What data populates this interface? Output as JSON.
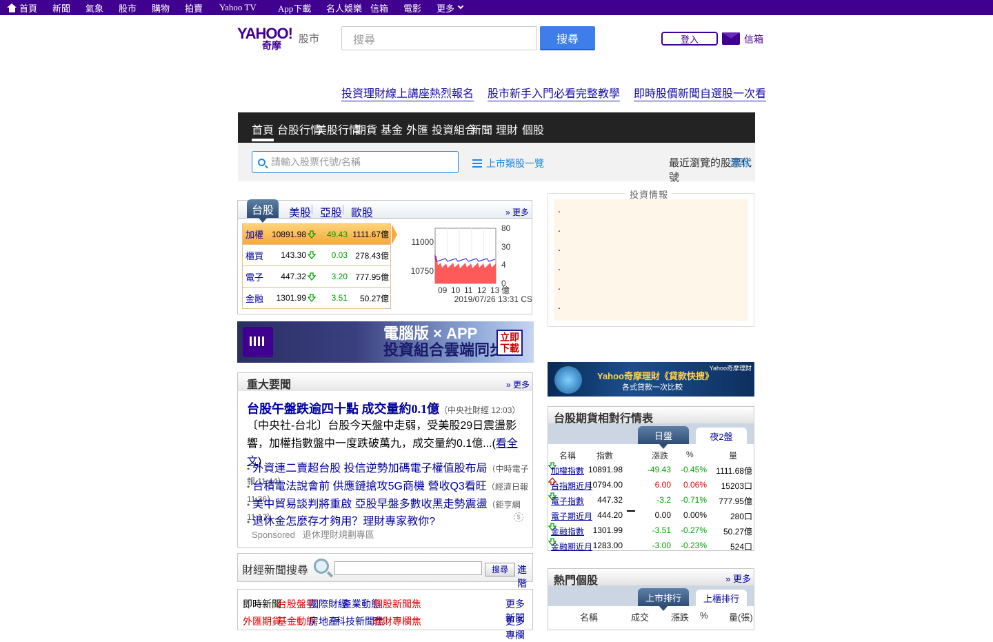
{
  "topbar": {
    "items": [
      "首頁",
      "新聞",
      "氣象",
      "股市",
      "購物",
      "拍賣",
      "Yahoo TV",
      "App下載",
      "名人娛樂",
      "信箱",
      "電影",
      "更多"
    ]
  },
  "header": {
    "logo_main": "YAHOO!",
    "logo_sub": "奇摩",
    "logo_section": "股市",
    "search_placeholder": "搜尋",
    "search_button": "搜尋",
    "login": "登入",
    "mail": "信箱"
  },
  "promo_links": [
    "投資理財線上講座熱烈報名",
    "股市新手入門必看完整教學",
    "即時股價新聞自選股一次看"
  ],
  "nav": {
    "items": [
      "首頁",
      "台股行情",
      "美股行情",
      "期貨",
      "基金",
      "外匯",
      "投資組合",
      "新聞",
      "理財",
      "個股"
    ],
    "active_index": 0
  },
  "subbar": {
    "stock_placeholder": "請輸入股票代號/名稱",
    "list_link": "上市類股一覽",
    "right_text": "最近瀏覽的股票代號",
    "right_link": "清除"
  },
  "index_box": {
    "tabs": [
      "台股",
      "美股",
      "亞股",
      "歐股"
    ],
    "more": "更多",
    "rows": [
      {
        "name": "加權",
        "value": "10891.98",
        "change": "49.43",
        "amount": "1111.67億",
        "dir": "down"
      },
      {
        "name": "櫃買",
        "value": "143.30",
        "change": "0.03",
        "amount": "278.43億",
        "dir": "down"
      },
      {
        "name": "電子",
        "value": "447.32",
        "change": "3.20",
        "amount": "777.95億",
        "dir": "down"
      },
      {
        "name": "金融",
        "value": "1301.99",
        "change": "3.51",
        "amount": "50.27億",
        "dir": "down"
      }
    ],
    "chart": {
      "left_ticks": [
        "11000",
        "10750"
      ],
      "right_ticks": [
        "80",
        "30",
        "4",
        "0"
      ],
      "right_unit": "億",
      "x_ticks": [
        "09",
        "10",
        "11",
        "12",
        "13"
      ],
      "timestamp": "2019/07/26 13:31 CST"
    }
  },
  "banner1": {
    "logo": "YAHOO!",
    "line1": "電腦版 × APP",
    "line2": "投資組合雲端同步",
    "cta": "立即下載"
  },
  "news": {
    "title": "重大要聞",
    "more": "更多",
    "lead": {
      "headline": "台股午盤跌逾四十點 成交量約0.1億",
      "source": "中央社財經 12:03"
    },
    "lead_body": "〔中央社-台北〕台股今天盤中走弱，受美股29日震盪影響，加權指數盤中一度跌破萬九，成交量約0.1億...",
    "lead_more": "看全文",
    "items": [
      {
        "title": "外資連二賣超台股 投信逆勢加碼電子權值股布局",
        "source": "中時電子報 11:44"
      },
      {
        "title": "台積電法說會前 供應鏈搶攻5G商機 營收Q3看旺",
        "source": "經濟日報 11:36"
      },
      {
        "title": "美中貿易談判將重啟 亞股早盤多數收黑走勢震盪",
        "source": "鉅亨網 11:17"
      },
      {
        "title": "退休金怎麼存才夠用？理財專家教你?",
        "source": ""
      }
    ],
    "sponsored": "Sponsored",
    "sponsor_name": "退休理財規劃專區"
  },
  "news_search": {
    "label": "財經新聞搜尋",
    "button": "搜尋",
    "more": "進階"
  },
  "categories": {
    "row1": [
      "即時新聞",
      "台股盤勢",
      "國際財經",
      "產業動態",
      "個股新聞焦",
      "更多新聞"
    ],
    "row2": [
      "外匯期貨",
      "基金動態",
      "房地產",
      "科技新聞焦",
      "理財專欄焦",
      "更多專欄"
    ]
  },
  "invest": {
    "title": "投資情報",
    "items": [
      ".",
      ".",
      ".",
      ".",
      ".",
      "."
    ]
  },
  "banner2": {
    "corner": "Yahoo奇摩理財",
    "line1": "Yahoo奇摩理財《貸款快搜》",
    "line2": "各式貸款一次比較"
  },
  "futures": {
    "title": "台股期貨相對行情表",
    "tabs": [
      "日盤",
      "夜2盤"
    ],
    "headers": [
      "名稱",
      "指數",
      "漲跌",
      "%",
      "量"
    ],
    "rows": [
      {
        "name": "加權指數",
        "value": "10891.98",
        "dir": "down",
        "change": "-49.43",
        "pct": "-0.45%",
        "vol": "1111.68億",
        "color": "#00a000"
      },
      {
        "name": "台指期近月",
        "value": "10794.00",
        "dir": "up",
        "change": "6.00",
        "pct": "0.06%",
        "vol": "15203口",
        "color": "#e00000"
      },
      {
        "name": "電子指數",
        "value": "447.32",
        "dir": "down",
        "change": "-3.2",
        "pct": "-0.71%",
        "vol": "777.95億",
        "color": "#00a000"
      },
      {
        "name": "電子期近月",
        "value": "444.20",
        "dir": "flat",
        "change": "0.00",
        "pct": "0.00%",
        "vol": "280口",
        "color": "#000000"
      },
      {
        "name": "金融指數",
        "value": "1301.99",
        "dir": "down",
        "change": "-3.51",
        "pct": "-0.27%",
        "vol": "50.27億",
        "color": "#00a000"
      },
      {
        "name": "金融期近月",
        "value": "1283.00",
        "dir": "down",
        "change": "-3.00",
        "pct": "-0.23%",
        "vol": "524口",
        "color": "#00a000"
      }
    ]
  },
  "hot": {
    "title": "熱門個股",
    "more": "更多",
    "tabs": [
      "上市排行",
      "上櫃排行"
    ],
    "headers": [
      "名稱",
      "成交",
      "漲跌",
      "%",
      "量(張)"
    ]
  },
  "colors": {
    "brand": "#400090",
    "link": "#00009c",
    "up": "#e00000",
    "down": "#00a000",
    "search_btn": "#3d7ee8"
  }
}
